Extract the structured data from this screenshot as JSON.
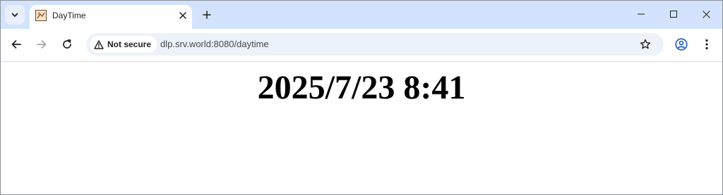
{
  "browser": {
    "tab": {
      "title": "DayTime",
      "favicon": "page-favicon"
    },
    "security": {
      "label": "Not secure",
      "icon": "warning-triangle-icon"
    },
    "url": "dlp.srv.world:8080/daytime",
    "icons": {
      "tab_search": "chevron-down-icon",
      "tab_close": "close-icon",
      "new_tab": "plus-icon",
      "minimize": "minimize-icon",
      "maximize": "maximize-icon",
      "close_window": "close-icon",
      "back": "back-arrow-icon",
      "forward": "forward-arrow-icon",
      "reload": "reload-icon",
      "bookmark": "star-icon",
      "profile": "profile-icon",
      "menu": "kebab-menu-icon"
    },
    "colors": {
      "tabstrip": "#d3e3fd",
      "omnibox": "#edf2fa",
      "page_background": "#ffffff"
    }
  },
  "page": {
    "daytime": "2025/7/23 8:41"
  }
}
